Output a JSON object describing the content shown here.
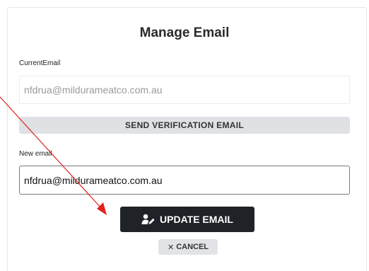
{
  "dialog": {
    "title": "Manage Email"
  },
  "current_email": {
    "label": "CurrentEmail",
    "value": "nfdrua@mildurameatco.com.au"
  },
  "verify": {
    "label": "SEND VERIFICATION EMAIL"
  },
  "new_email": {
    "label": "New email",
    "value": "nfdrua@mildurameatco.com.au"
  },
  "actions": {
    "update_label": "UPDATE EMAIL",
    "update_icon": "user-edit-icon",
    "cancel_label": "CANCEL",
    "cancel_icon": "close-icon"
  },
  "annotation": {
    "arrow_color": "#e02020"
  }
}
